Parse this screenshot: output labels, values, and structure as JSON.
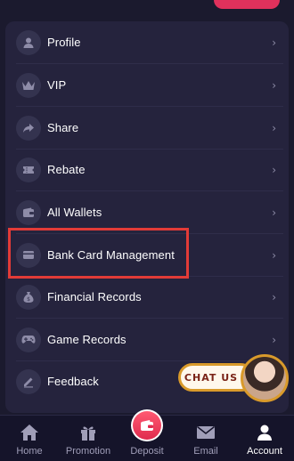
{
  "menu": {
    "items": [
      {
        "label": "Profile",
        "icon": "person-icon"
      },
      {
        "label": "VIP",
        "icon": "crown-icon"
      },
      {
        "label": "Share",
        "icon": "share-icon"
      },
      {
        "label": "Rebate",
        "icon": "ticket-icon"
      },
      {
        "label": "All Wallets",
        "icon": "wallet-icon"
      },
      {
        "label": "Bank Card Management",
        "icon": "card-icon"
      },
      {
        "label": "Financial Records",
        "icon": "money-bag-icon"
      },
      {
        "label": "Game Records",
        "icon": "gamepad-icon"
      },
      {
        "label": "Feedback",
        "icon": "edit-icon"
      }
    ],
    "chevron": "›"
  },
  "chat": {
    "label": "CHAT US"
  },
  "tabs": [
    {
      "label": "Home",
      "icon": "home-icon",
      "active": false
    },
    {
      "label": "Promotion",
      "icon": "gift-icon",
      "active": false
    },
    {
      "label": "Deposit",
      "icon": "wallet-icon",
      "active": false
    },
    {
      "label": "Email",
      "icon": "mail-icon",
      "active": false
    },
    {
      "label": "Account",
      "icon": "user-icon",
      "active": true
    }
  ],
  "colors": {
    "background": "#1b1a2e",
    "card": "#25233d",
    "accent": "#e0315c",
    "highlight_border": "#e23b37",
    "chat_border": "#d99a2b"
  }
}
